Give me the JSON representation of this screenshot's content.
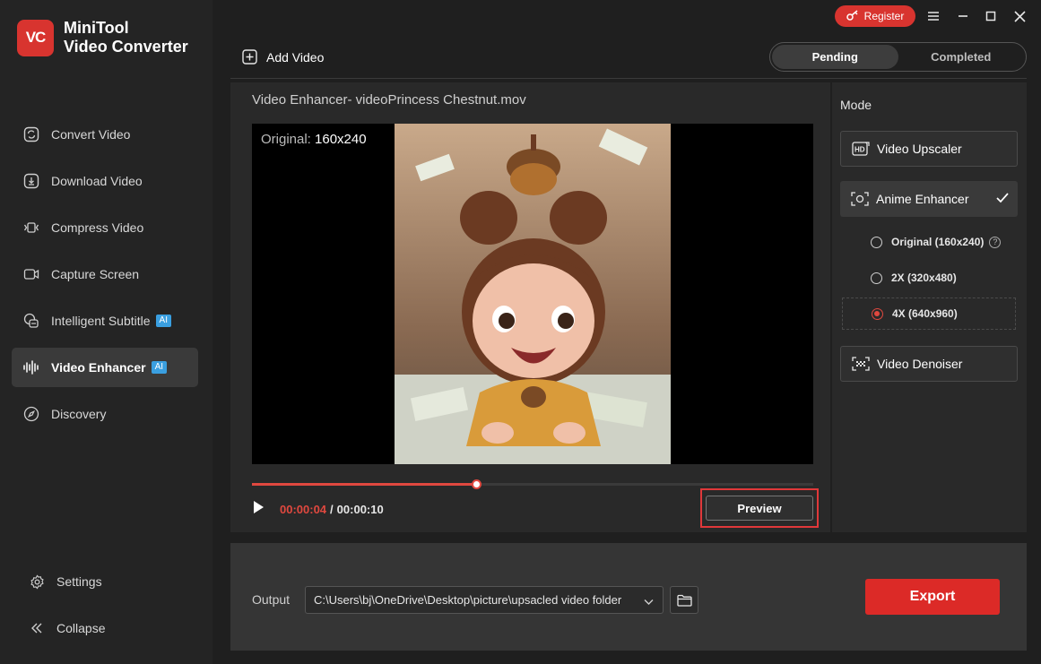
{
  "app": {
    "logo_badge": "VC",
    "name_line1": "MiniTool",
    "name_line2": "Video Converter",
    "accent_color": "#d8342f"
  },
  "sidebar": {
    "items": [
      {
        "label": "Convert Video",
        "icon": "convert-icon"
      },
      {
        "label": "Download Video",
        "icon": "download-icon"
      },
      {
        "label": "Compress Video",
        "icon": "compress-icon"
      },
      {
        "label": "Capture Screen",
        "icon": "capture-icon"
      },
      {
        "label": "Intelligent Subtitle",
        "icon": "subtitle-icon",
        "badge": "AI"
      },
      {
        "label": "Video Enhancer",
        "icon": "enhancer-icon",
        "badge": "AI",
        "active": true
      },
      {
        "label": "Discovery",
        "icon": "compass-icon"
      }
    ],
    "settings_label": "Settings",
    "collapse_label": "Collapse"
  },
  "topbar": {
    "register_label": "Register"
  },
  "toolbar": {
    "add_video_label": "Add Video",
    "tabs": [
      {
        "label": "Pending",
        "active": true
      },
      {
        "label": "Completed",
        "active": false
      }
    ]
  },
  "editor": {
    "title": "Video Enhancer- videoPrincess Chestnut.mov",
    "original_prefix": "Original:",
    "original_res": "160x240",
    "current_time": "00:00:04",
    "separator": "/",
    "total_time": "00:00:10",
    "progress": 0.4,
    "preview_label": "Preview"
  },
  "mode": {
    "title": "Mode",
    "upscaler_label": "Video Upscaler",
    "anime_label": "Anime Enhancer",
    "options": [
      {
        "label": "Original (160x240)",
        "selected": false,
        "help": "?"
      },
      {
        "label": "2X (320x480)",
        "selected": false
      },
      {
        "label": "4X (640x960)",
        "selected": true
      }
    ],
    "denoiser_label": "Video Denoiser"
  },
  "output": {
    "label": "Output",
    "path": "C:\\Users\\bj\\OneDrive\\Desktop\\picture\\upsacled video folder",
    "export_label": "Export"
  }
}
